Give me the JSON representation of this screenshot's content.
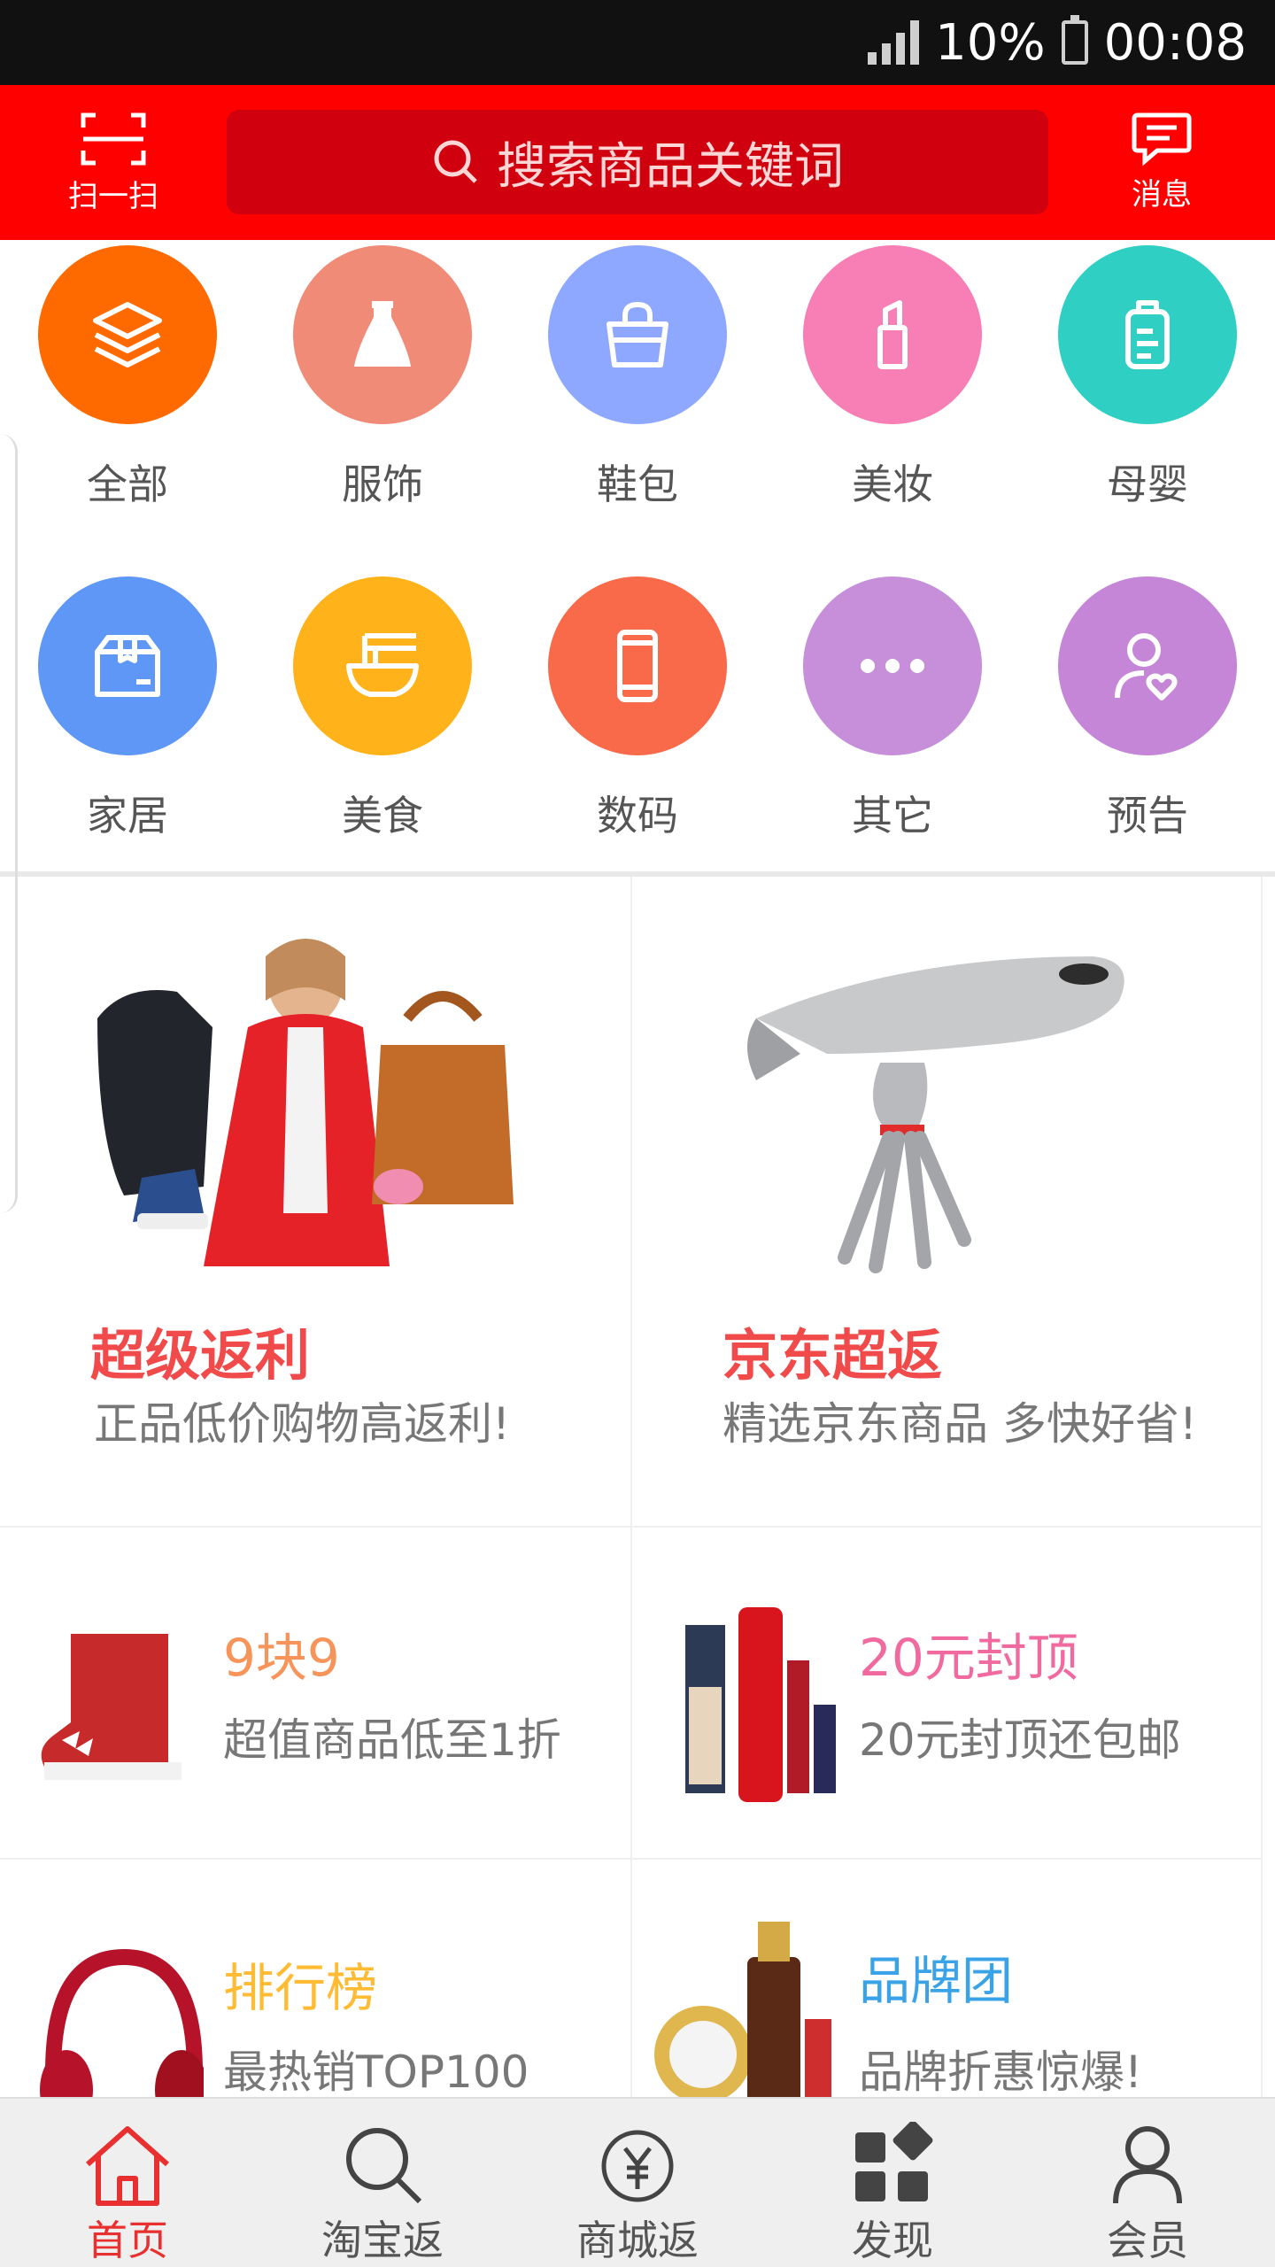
{
  "status_bar": {
    "battery": "10%",
    "time": "00:08"
  },
  "header": {
    "scan_label": "扫一扫",
    "search_placeholder": "搜索商品关键词",
    "message_label": "消息",
    "accent_color": "#ff0000"
  },
  "categories": [
    {
      "label": "全部",
      "icon": "layers-icon",
      "color": "#ff6a00"
    },
    {
      "label": "服饰",
      "icon": "dress-icon",
      "color": "#f08b77"
    },
    {
      "label": "鞋包",
      "icon": "handbag-icon",
      "color": "#8fa8ff"
    },
    {
      "label": "美妆",
      "icon": "lipstick-icon",
      "color": "#f77fb6"
    },
    {
      "label": "母婴",
      "icon": "baby-bottle-icon",
      "color": "#2fcfc3"
    },
    {
      "label": "家居",
      "icon": "box-icon",
      "color": "#5e97f6"
    },
    {
      "label": "美食",
      "icon": "noodle-bowl-icon",
      "color": "#ffb21a"
    },
    {
      "label": "数码",
      "icon": "phone-icon",
      "color": "#f96a4a"
    },
    {
      "label": "其它",
      "icon": "more-dots-icon",
      "color": "#c78fda"
    },
    {
      "label": "预告",
      "icon": "user-heart-icon",
      "color": "#c586d8"
    }
  ],
  "promos": {
    "super_rebate": {
      "title": "超级返利",
      "subtitle": "正品低价购物高返利!"
    },
    "jd_rebate": {
      "title": "京东超返",
      "subtitle": "精选京东商品 多快好省!"
    }
  },
  "tiles": [
    {
      "title": "9块9",
      "subtitle": "超值商品低至1折",
      "color": "#f7945a"
    },
    {
      "title": "20元封顶",
      "subtitle": "20元封顶还包邮",
      "color": "#f06aa0"
    },
    {
      "title": "排行榜",
      "subtitle": "最热销TOP100",
      "color": "#ffbb33"
    },
    {
      "title": "品牌团",
      "subtitle": "品牌折惠惊爆!",
      "color": "#3aa3e8"
    }
  ],
  "bottom_nav": [
    {
      "label": "首页",
      "icon": "home-icon",
      "active": true
    },
    {
      "label": "淘宝返",
      "icon": "search-icon",
      "active": false
    },
    {
      "label": "商城返",
      "icon": "yen-icon",
      "active": false
    },
    {
      "label": "发现",
      "icon": "discover-grid-icon",
      "active": false
    },
    {
      "label": "会员",
      "icon": "user-icon",
      "active": false
    }
  ]
}
